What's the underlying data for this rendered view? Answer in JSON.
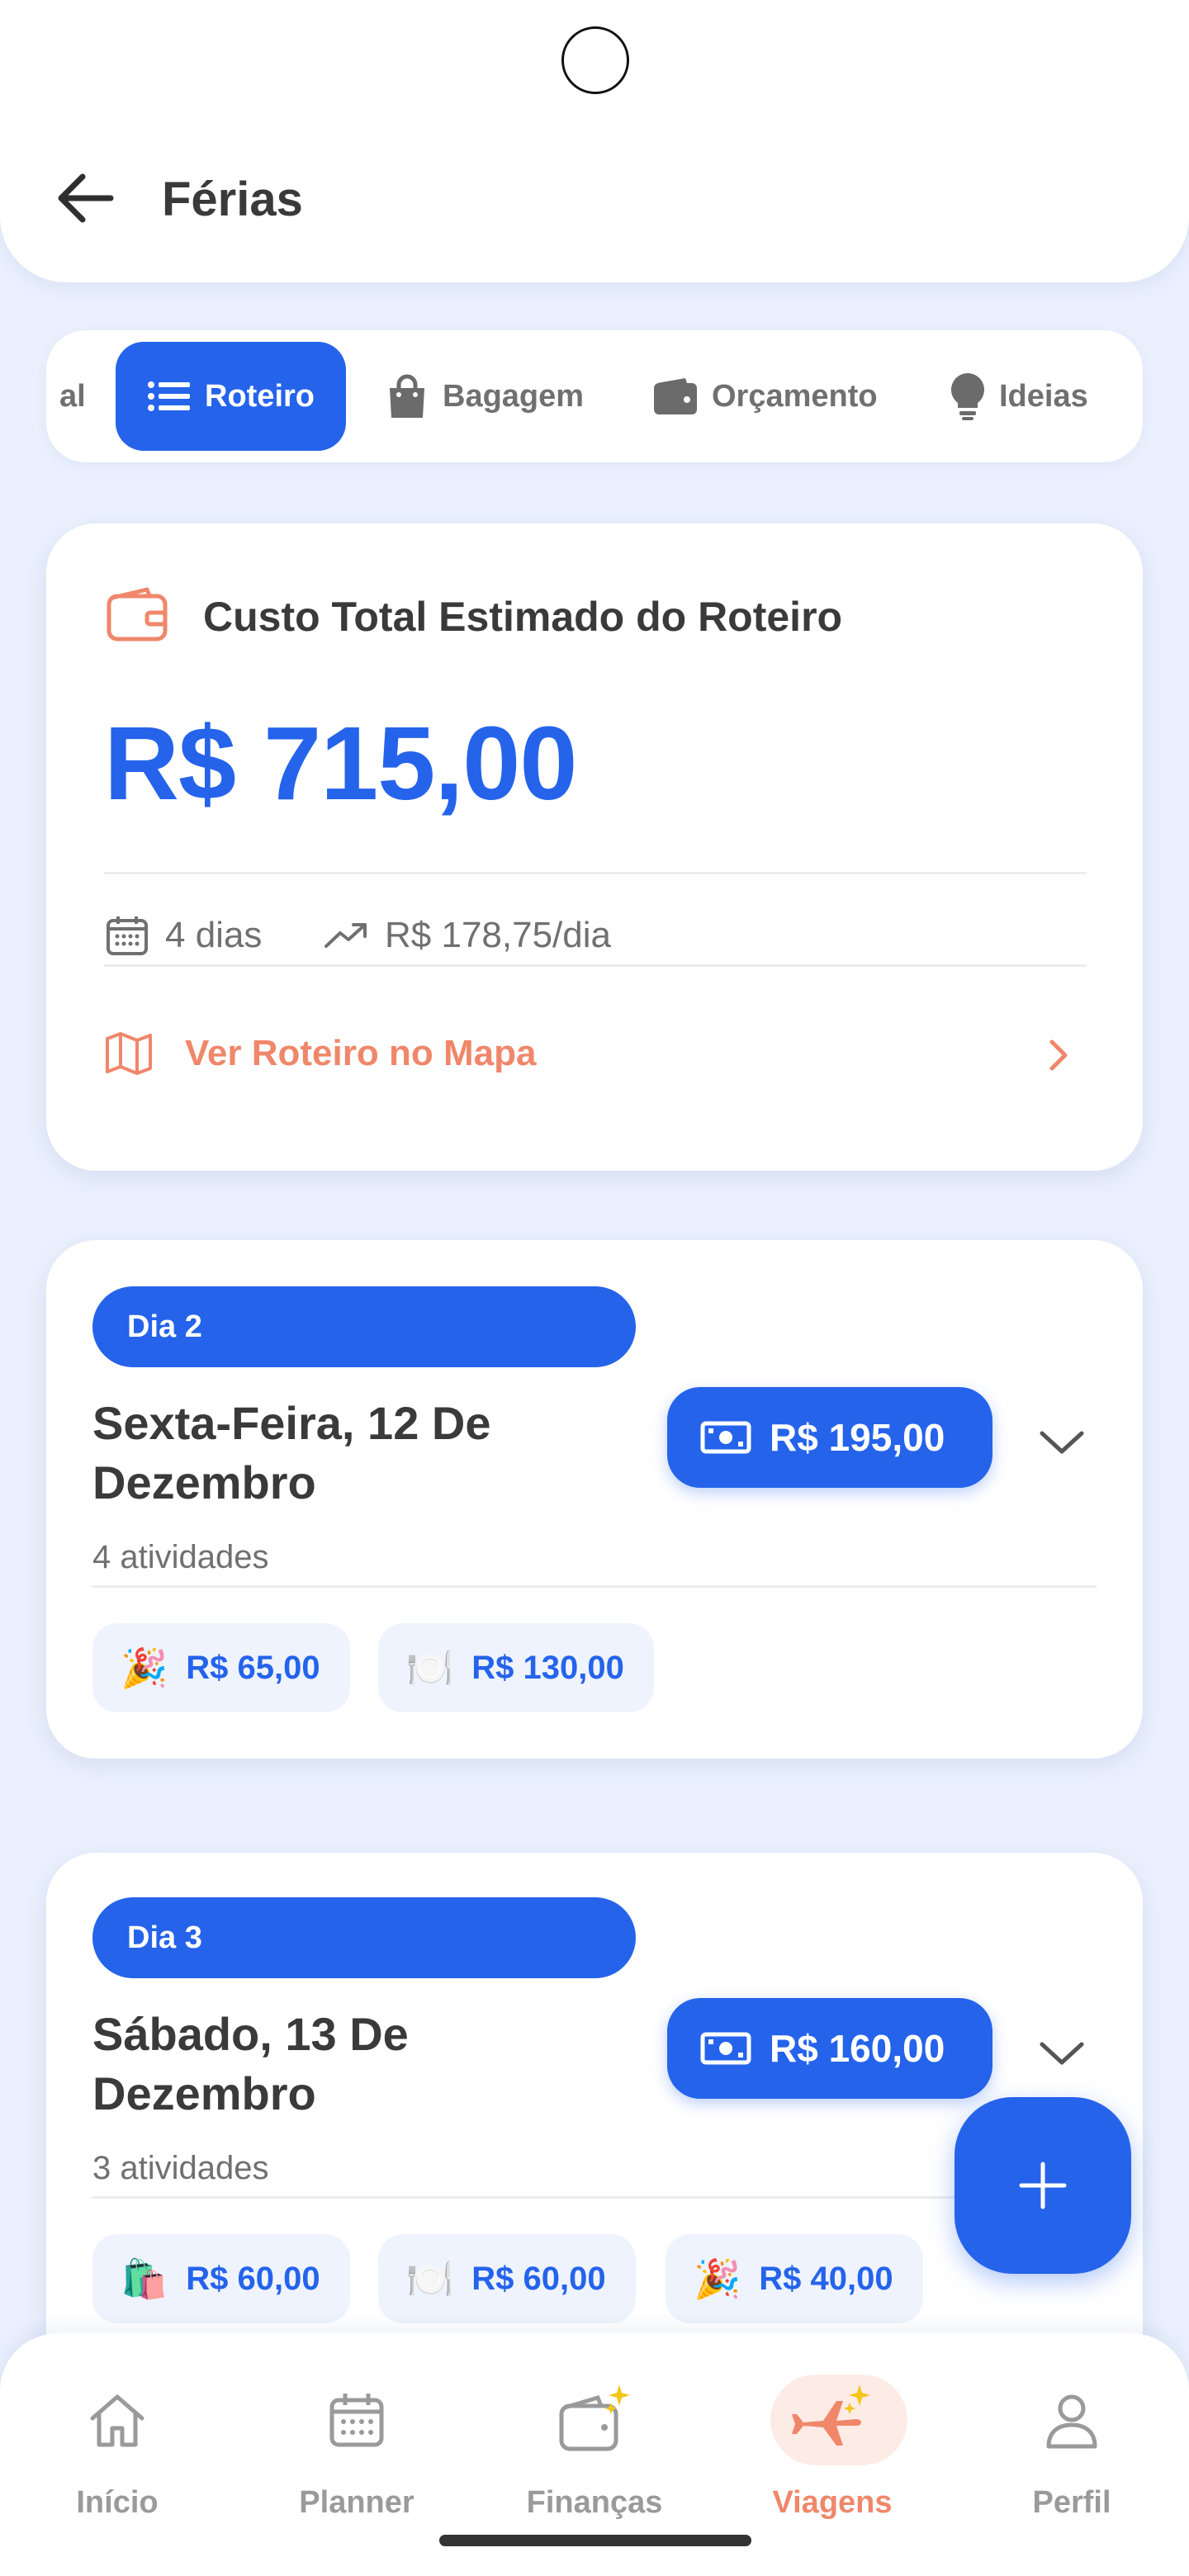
{
  "header": {
    "title": "Férias"
  },
  "tabs": [
    {
      "label": "al"
    },
    {
      "label": "Roteiro",
      "active": true
    },
    {
      "label": "Bagagem"
    },
    {
      "label": "Orçamento"
    },
    {
      "label": "Ideias"
    }
  ],
  "summary": {
    "title": "Custo Total Estimado do Roteiro",
    "amount": "R$ 715,00",
    "days": "4 dias",
    "per_day": "R$ 178,75/dia",
    "map_link": "Ver Roteiro no Mapa"
  },
  "days": [
    {
      "pill": "Dia 2",
      "title": "Sexta-Feira, 12 De Dezembro",
      "total": "R$ 195,00",
      "count": "4 atividades",
      "chips": [
        {
          "emoji": "🎉",
          "amount": "R$ 65,00"
        },
        {
          "emoji": "🍽️",
          "amount": "R$ 130,00"
        }
      ]
    },
    {
      "pill": "Dia 3",
      "title": "Sábado, 13 De Dezembro",
      "total": "R$ 160,00",
      "count": "3 atividades",
      "chips": [
        {
          "emoji": "🛍️",
          "amount": "R$ 60,00"
        },
        {
          "emoji": "🍽️",
          "amount": "R$ 60,00"
        },
        {
          "emoji": "🎉",
          "amount": "R$ 40,00"
        }
      ]
    }
  ],
  "nav": [
    {
      "label": "Início",
      "icon": "home-icon"
    },
    {
      "label": "Planner",
      "icon": "calendar-icon"
    },
    {
      "label": "Finanças",
      "icon": "wallet-sparkle-icon"
    },
    {
      "label": "Viagens",
      "icon": "plane-sparkle-icon",
      "active": true
    },
    {
      "label": "Perfil",
      "icon": "user-icon"
    }
  ],
  "colors": {
    "primary": "#2563eb",
    "accent": "#f0876a",
    "background": "#eaf0fd"
  }
}
